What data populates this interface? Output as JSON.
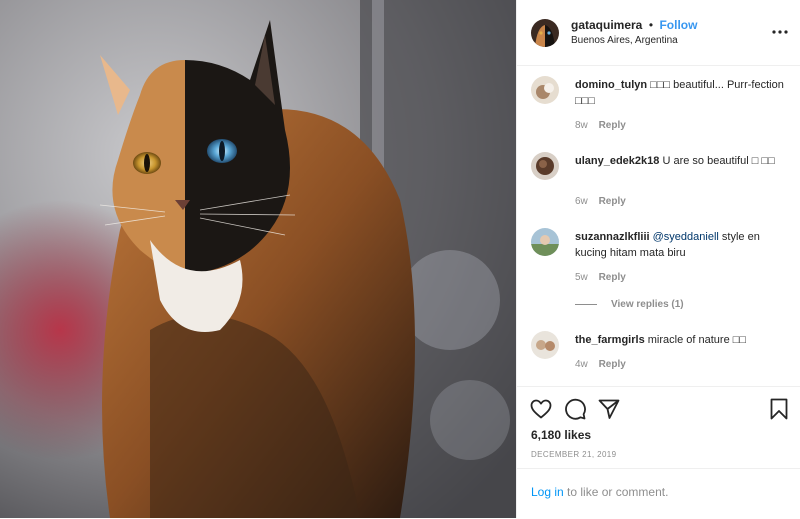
{
  "post": {
    "username": "gataquimera",
    "separator": "•",
    "follow_label": "Follow",
    "location": "Buenos Aires, Argentina"
  },
  "comments": [
    {
      "username": "domino_tulyn",
      "text": "□□□ beautiful... Purr-fection □□□",
      "age": "8w",
      "reply_label": "Reply"
    },
    {
      "username": "ulany_edek2k18",
      "text": "U are so beautiful □ □□",
      "age": "6w",
      "reply_label": "Reply"
    },
    {
      "username": "suzannazlkfliii",
      "mention": "@syeddaniell",
      "text": " style en kucing hitam mata biru",
      "age": "5w",
      "reply_label": "Reply",
      "view_replies": "View replies (1)"
    },
    {
      "username": "the_farmgirls",
      "text": "miracle of nature □□",
      "age": "4w",
      "reply_label": "Reply"
    }
  ],
  "engagement": {
    "likes": "6,180 likes",
    "date": "DECEMBER 21, 2019"
  },
  "login": {
    "link": "Log in",
    "rest": " to like or comment."
  },
  "icons": [
    "more-options-icon",
    "heart-icon",
    "comment-icon",
    "share-icon",
    "bookmark-icon"
  ],
  "colors": {
    "link": "#3897f0",
    "muted": "#8e8e8e",
    "text": "#262626",
    "border": "#efefef"
  }
}
